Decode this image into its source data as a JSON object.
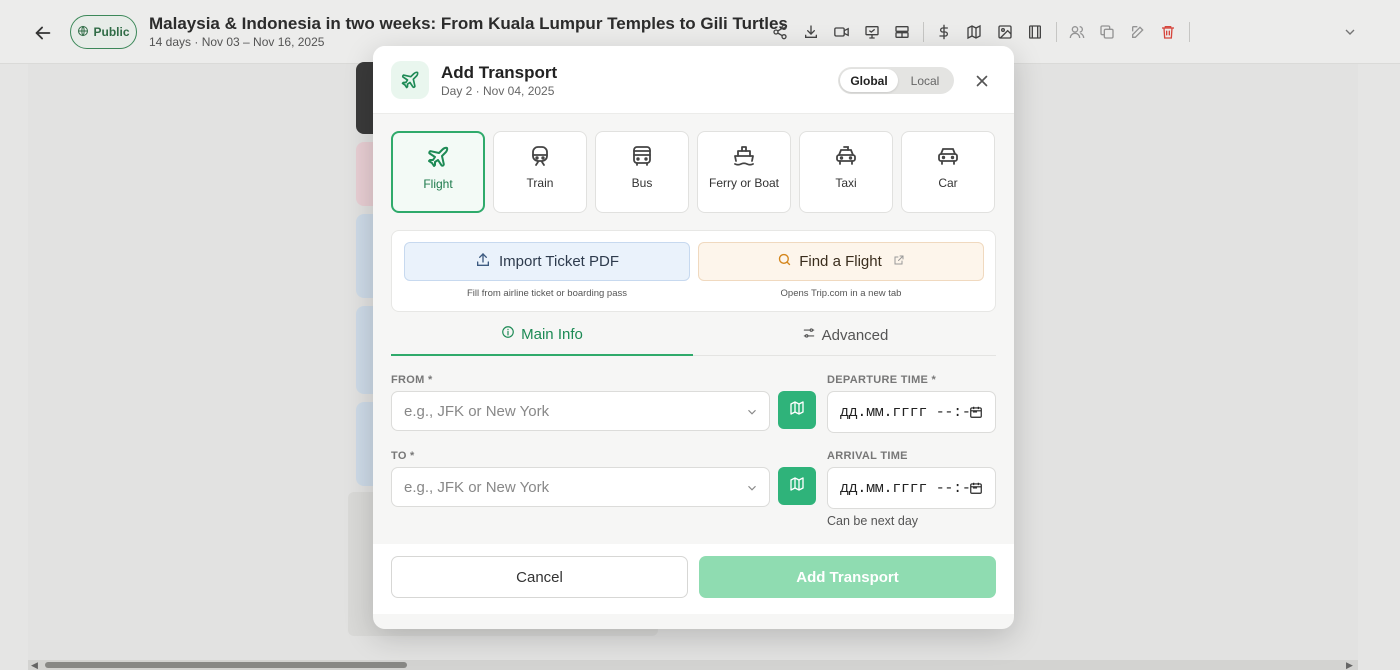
{
  "header": {
    "visibility_label": "Public",
    "trip_title": "Malaysia & Indonesia in two weeks: From Kuala Lumpur Temples to Gili Turtles",
    "trip_meta": "14 days · Nov 03 – Nov 16, 2025",
    "toolbar_icons": [
      "share-icon",
      "download-icon",
      "video-icon",
      "presentation-icon",
      "layout-icon",
      "dollar-icon",
      "map-icon",
      "image-icon",
      "columns-icon",
      "users-icon",
      "copy-icon",
      "edit-icon",
      "trash-icon"
    ]
  },
  "modal": {
    "title": "Add Transport",
    "subtitle": "Day 2 · Nov 04, 2025",
    "scope": {
      "options": [
        "Global",
        "Local"
      ],
      "selected": "Global"
    },
    "modes": [
      {
        "label": "Flight",
        "icon": "plane-icon",
        "selected": true
      },
      {
        "label": "Train",
        "icon": "train-icon",
        "selected": false
      },
      {
        "label": "Bus",
        "icon": "bus-icon",
        "selected": false
      },
      {
        "label": "Ferry or Boat",
        "icon": "ship-icon",
        "selected": false
      },
      {
        "label": "Taxi",
        "icon": "taxi-icon",
        "selected": false
      },
      {
        "label": "Car",
        "icon": "car-icon",
        "selected": false
      }
    ],
    "helpers": {
      "import_label": "Import Ticket PDF",
      "import_note": "Fill from airline ticket or boarding pass",
      "find_label": "Find a Flight",
      "find_note": "Opens Trip.com in a new tab"
    },
    "tabs": {
      "main": "Main Info",
      "advanced": "Advanced",
      "active": "Main Info"
    },
    "form": {
      "from_label": "FROM *",
      "from_placeholder": "e.g., JFK or New York",
      "to_label": "TO *",
      "to_placeholder": "e.g., JFK or New York",
      "departure_label": "DEPARTURE TIME *",
      "departure_value": "дд.мм.гггг --:--",
      "arrival_label": "ARRIVAL TIME",
      "arrival_value": "дд.мм.гггг --:--",
      "arrival_hint": "Can be next day"
    },
    "footer": {
      "cancel": "Cancel",
      "submit": "Add Transport"
    }
  },
  "colors": {
    "accent": "#2faa6b",
    "accent_light": "#8fdcb1",
    "danger": "#e0473d"
  }
}
